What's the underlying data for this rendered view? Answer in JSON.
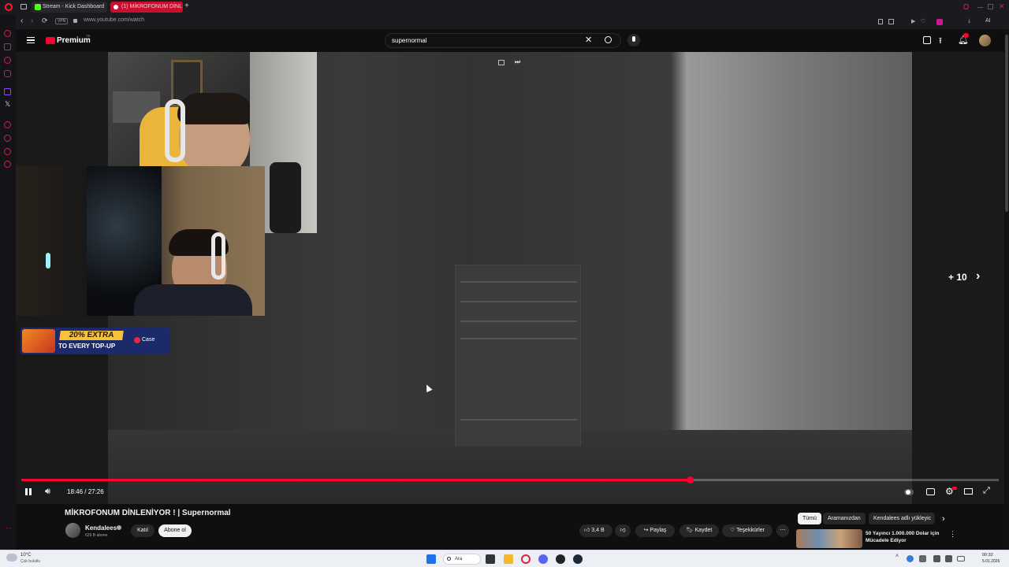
{
  "browser": {
    "tabs": [
      {
        "label": "Stream - Kick Dashboard",
        "icon": "kick-icon",
        "color": "#53fc18"
      },
      {
        "label": "(1) MİKROFONUM DİNL",
        "icon": "youtube-audio-icon",
        "color": "#ff0033"
      }
    ],
    "url": "www.youtube.com/watch",
    "vpn_label": "VPN",
    "ai_label": "AI"
  },
  "youtube": {
    "logo_text": "Premium",
    "logo_sup": "TR",
    "search_value": "supernormal"
  },
  "video": {
    "current_time": "18:46",
    "duration": "27:26",
    "timecode": "18:46 / 27:26",
    "progress_fraction": 0.684,
    "skip_label": "+ 10",
    "title": "MİKROFONUM DİNLENİYOR ! | Supernormal"
  },
  "ad": {
    "headline": "20% EXTRA",
    "subline": "TO EVERY TOP-UP",
    "brand": "Case"
  },
  "channel": {
    "name": "Kendalees",
    "subscribers": "629 B abone",
    "join_label": "Katıl",
    "subscribe_label": "Abone ol"
  },
  "actions": {
    "likes": "3,4 B",
    "share": "Paylaş",
    "save": "Kaydet",
    "thanks": "Teşekkürler"
  },
  "sidebar": {
    "chips": [
      "Tümü",
      "Aramanızdan",
      "Kendalees adlı yükleyic"
    ],
    "rec_title_line1": "50 Yayıncı 1.000.000 Dolar için",
    "rec_title_line2": "Mücadele Ediyor"
  },
  "taskbar": {
    "weather_temp": "10°C",
    "weather_desc": "Çok bulutlu",
    "search_label": "Ara",
    "time": "00:32",
    "date": "5.01.2026"
  },
  "colors": {
    "accent": "#ff0033",
    "kick": "#53fc18"
  }
}
